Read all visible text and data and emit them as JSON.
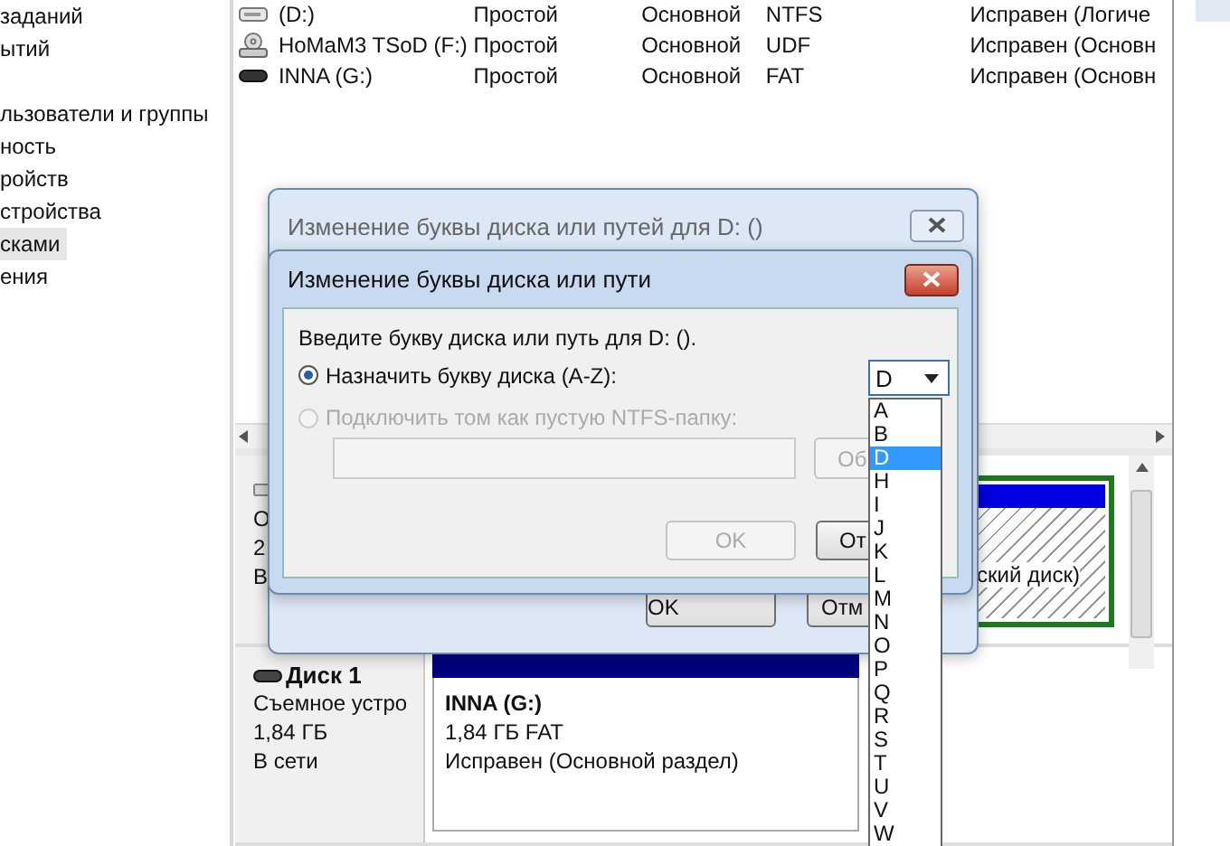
{
  "sidebar": {
    "groups": [
      {
        "items": [
          {
            "label": "заданий",
            "selected": false
          },
          {
            "label": "ытий",
            "selected": false
          }
        ]
      },
      {
        "items": [
          {
            "label": "льзователи и группы",
            "selected": false
          },
          {
            "label": "ность",
            "selected": false
          },
          {
            "label": "ройств",
            "selected": false
          },
          {
            "label": "стройства",
            "selected": false
          },
          {
            "label": "сками",
            "selected": true
          },
          {
            "label": "ения",
            "selected": false
          }
        ]
      }
    ]
  },
  "volumes": {
    "rows": [
      {
        "kind": "hdd",
        "name": "(D:)",
        "layout": "Простой",
        "type": "Основной",
        "file_system": "NTFS",
        "status": "Исправен (Логиче"
      },
      {
        "kind": "disc",
        "name": "HoMaM3 TSoD (F:)",
        "layout": "Простой",
        "type": "Основной",
        "file_system": "UDF",
        "status": "Исправен (Основн"
      },
      {
        "kind": "removable",
        "name": "INNA (G:)",
        "layout": "Простой",
        "type": "Основной",
        "file_system": "FAT",
        "status": "Исправен (Основн"
      }
    ]
  },
  "disks": [
    {
      "kind": "basic",
      "lines": [
        "О",
        "2",
        "В"
      ],
      "partition": {
        "kind": "logical",
        "lines": [
          "ский диск)"
        ]
      }
    },
    {
      "kind": "removable",
      "name": "Диск 1",
      "lines": [
        "Съемное устро",
        "1,84 ГБ",
        "В сети"
      ],
      "partition": {
        "kind": "primary",
        "title": "INNA  (G:)",
        "lines": [
          "1,84 ГБ FAT",
          "Исправен (Основной раздел)"
        ]
      }
    }
  ],
  "back_dialog": {
    "title": "Изменение буквы диска или путей для D: ()",
    "buttons": [
      "OK",
      "Отм"
    ]
  },
  "dialog": {
    "title": "Изменение буквы диска или пути",
    "prompt": "Введите букву диска или путь для D: ().",
    "options": [
      {
        "label": "Назначить букву диска (A-Z):",
        "selected": true,
        "disabled": false
      },
      {
        "label": "Подключить том как пустую NTFS-папку:",
        "selected": false,
        "disabled": true
      }
    ],
    "path_field": {
      "disabled": true
    },
    "browse_button": {
      "label": "Об",
      "disabled": true
    },
    "buttons": [
      {
        "label": "OK",
        "disabled": true
      },
      {
        "label": "От",
        "disabled": false
      }
    ],
    "drive_letter": {
      "value": "D",
      "options": [
        {
          "label": "A",
          "selected": false
        },
        {
          "label": "B",
          "selected": false
        },
        {
          "label": "D",
          "selected": true
        },
        {
          "label": "H",
          "selected": false
        },
        {
          "label": "I",
          "selected": false
        },
        {
          "label": "J",
          "selected": false
        },
        {
          "label": "K",
          "selected": false
        },
        {
          "label": "L",
          "selected": false
        },
        {
          "label": "M",
          "selected": false
        },
        {
          "label": "N",
          "selected": false
        },
        {
          "label": "O",
          "selected": false
        },
        {
          "label": "P",
          "selected": false
        },
        {
          "label": "Q",
          "selected": false
        },
        {
          "label": "R",
          "selected": false
        },
        {
          "label": "S",
          "selected": false
        },
        {
          "label": "T",
          "selected": false
        },
        {
          "label": "U",
          "selected": false
        },
        {
          "label": "V",
          "selected": false
        },
        {
          "label": "W",
          "selected": false
        }
      ]
    }
  }
}
